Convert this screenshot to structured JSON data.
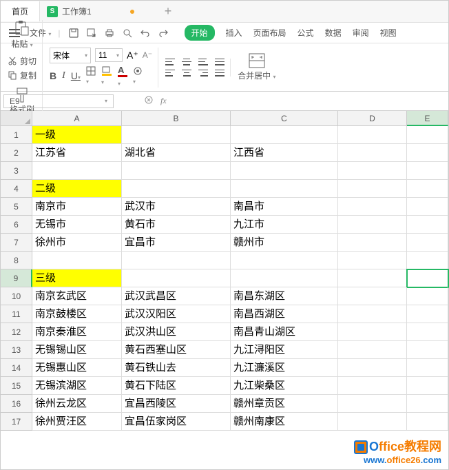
{
  "titlebar": {
    "home": "首页",
    "doc_icon": "S",
    "doc_name": "工作簿1",
    "add": "+"
  },
  "menubar": {
    "file": "文件",
    "tabs": {
      "start": "开始",
      "insert": "插入",
      "page_layout": "页面布局",
      "formulas": "公式",
      "data": "数据",
      "review": "审阅",
      "view": "视图"
    }
  },
  "ribbon": {
    "paste": "粘贴",
    "cut": "剪切",
    "copy": "复制",
    "format_painter": "格式刷",
    "font_name": "宋体",
    "font_size": "11",
    "increase_font": "A⁺",
    "decrease_font": "A⁻",
    "bold": "B",
    "italic": "I",
    "underline": "U",
    "fill_color_char": "A",
    "font_color_char": "A",
    "merge_center": "合并居中"
  },
  "formula_bar": {
    "name_box": "E9",
    "fx": "fx"
  },
  "grid": {
    "cols": [
      "A",
      "B",
      "C",
      "D",
      "E"
    ],
    "rows": [
      {
        "n": "1",
        "a": "一级",
        "b": "",
        "c": "",
        "ay": true
      },
      {
        "n": "2",
        "a": "江苏省",
        "b": "湖北省",
        "c": "江西省"
      },
      {
        "n": "3",
        "a": "",
        "b": "",
        "c": ""
      },
      {
        "n": "4",
        "a": "二级",
        "b": "",
        "c": "",
        "ay": true
      },
      {
        "n": "5",
        "a": "南京市",
        "b": "武汉市",
        "c": "南昌市"
      },
      {
        "n": "6",
        "a": "无锡市",
        "b": "黄石市",
        "c": "九江市"
      },
      {
        "n": "7",
        "a": "徐州市",
        "b": "宜昌市",
        "c": "赣州市"
      },
      {
        "n": "8",
        "a": "",
        "b": "",
        "c": ""
      },
      {
        "n": "9",
        "a": "三级",
        "b": "",
        "c": "",
        "ay": true,
        "active": true
      },
      {
        "n": "10",
        "a": "南京玄武区",
        "b": "武汉武昌区",
        "c": "南昌东湖区"
      },
      {
        "n": "11",
        "a": "南京鼓楼区",
        "b": "武汉汉阳区",
        "c": "南昌西湖区"
      },
      {
        "n": "12",
        "a": "南京秦淮区",
        "b": "武汉洪山区",
        "c": "南昌青山湖区"
      },
      {
        "n": "13",
        "a": "无锡锡山区",
        "b": "黄石西塞山区",
        "c": "九江浔阳区"
      },
      {
        "n": "14",
        "a": "无锡惠山区",
        "b": "黄石铁山去",
        "c": "九江濂溪区"
      },
      {
        "n": "15",
        "a": "无锡滨湖区",
        "b": "黄石下陆区",
        "c": "九江柴桑区"
      },
      {
        "n": "16",
        "a": "徐州云龙区",
        "b": "宜昌西陵区",
        "c": "赣州章贡区"
      },
      {
        "n": "17",
        "a": "徐州贾汪区",
        "b": "宜昌伍家岗区",
        "c": "赣州南康区"
      }
    ]
  },
  "watermark": {
    "line1_a": "O",
    "line1_b": "ffice教程网",
    "line2_a": "www.",
    "line2_b": "office26",
    "line2_c": ".com"
  }
}
